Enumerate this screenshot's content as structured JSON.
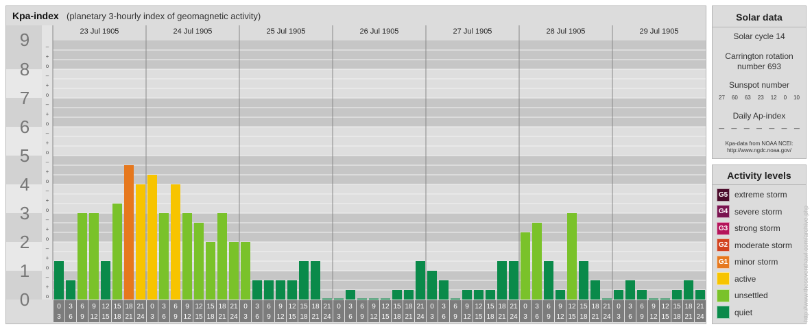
{
  "title": {
    "main": "Kpa-index",
    "subtitle": "(planetary 3-hourly index of geomagnetic activity)"
  },
  "chart_data": {
    "type": "bar",
    "title": "Kpa-index",
    "subtitle": "(planetary 3-hourly index of geomagnetic activity)",
    "ylim": [
      0,
      9
    ],
    "y_major_labels": [
      "0",
      "1",
      "2",
      "3",
      "4",
      "5",
      "6",
      "7",
      "8",
      "9"
    ],
    "y_minor_labels": [
      "–",
      "o",
      "+"
    ],
    "days": [
      "23 Jul 1905",
      "24 Jul 1905",
      "25 Jul 1905",
      "26 Jul 1905",
      "27 Jul 1905",
      "28 Jul 1905",
      "29 Jul 1905"
    ],
    "interval_start_labels": [
      "0",
      "3",
      "6",
      "9",
      "12",
      "15",
      "18",
      "21"
    ],
    "interval_end_labels": [
      "3",
      "6",
      "9",
      "12",
      "15",
      "18",
      "21",
      "24"
    ],
    "values": [
      1.333,
      0.667,
      3,
      3,
      1.333,
      3.333,
      4.667,
      4,
      4.333,
      3,
      4,
      3,
      2.667,
      2,
      3,
      2,
      2,
      0.667,
      0.667,
      0.667,
      0.667,
      1.333,
      1.333,
      0,
      0,
      0.333,
      0,
      0,
      0,
      0.333,
      0.333,
      1.333,
      1,
      0.667,
      0,
      0.333,
      0.333,
      0.333,
      1.333,
      1.333,
      2.333,
      2.667,
      1.333,
      0.333,
      3,
      1.333,
      0.667,
      0,
      0.333,
      0.667,
      0.333,
      0,
      0,
      0.333,
      0.667,
      0.333
    ],
    "colors": {
      "quiet": "#0a8a4a",
      "unsettled": "#7ac22a",
      "active": "#f7c400",
      "G1": "#e6781e",
      "G2": "#d2421e",
      "G3": "#b4145a",
      "G4": "#7a1450",
      "G5": "#4a0a2a"
    },
    "grid": true
  },
  "solar": {
    "title": "Solar data",
    "cycle": "Solar cycle 14",
    "carrington_line1": "Carrington rotation",
    "carrington_line2": "number 693",
    "sunspot_label": "Sunspot number",
    "sunspot_values": [
      "27",
      "60",
      "63",
      "23",
      "12",
      "0",
      "10"
    ],
    "ap_label": "Daily Ap-index",
    "ap_values": [
      "—",
      "—",
      "—",
      "—",
      "—",
      "—",
      "—"
    ],
    "source_line1": "Kpa-data from NOAA NCEI:",
    "source_line2": "http://www.ngdc.noaa.gov/"
  },
  "activity": {
    "title": "Activity levels",
    "items": [
      {
        "badge": "G5",
        "label": "extreme storm",
        "color": "#4a0a2a"
      },
      {
        "badge": "G4",
        "label": "severe storm",
        "color": "#7a1450"
      },
      {
        "badge": "G3",
        "label": "strong storm",
        "color": "#b4145a"
      },
      {
        "badge": "G2",
        "label": "moderate storm",
        "color": "#d2421e"
      },
      {
        "badge": "G1",
        "label": "minor storm",
        "color": "#e6781e"
      },
      {
        "badge": "",
        "label": "active",
        "color": "#f7c400"
      },
      {
        "badge": "",
        "label": "unsettled",
        "color": "#7ac22a"
      },
      {
        "badge": "",
        "label": "quiet",
        "color": "#0a8a4a"
      }
    ]
  },
  "watermark": "http://www.theseventhawl.com/archive.php"
}
